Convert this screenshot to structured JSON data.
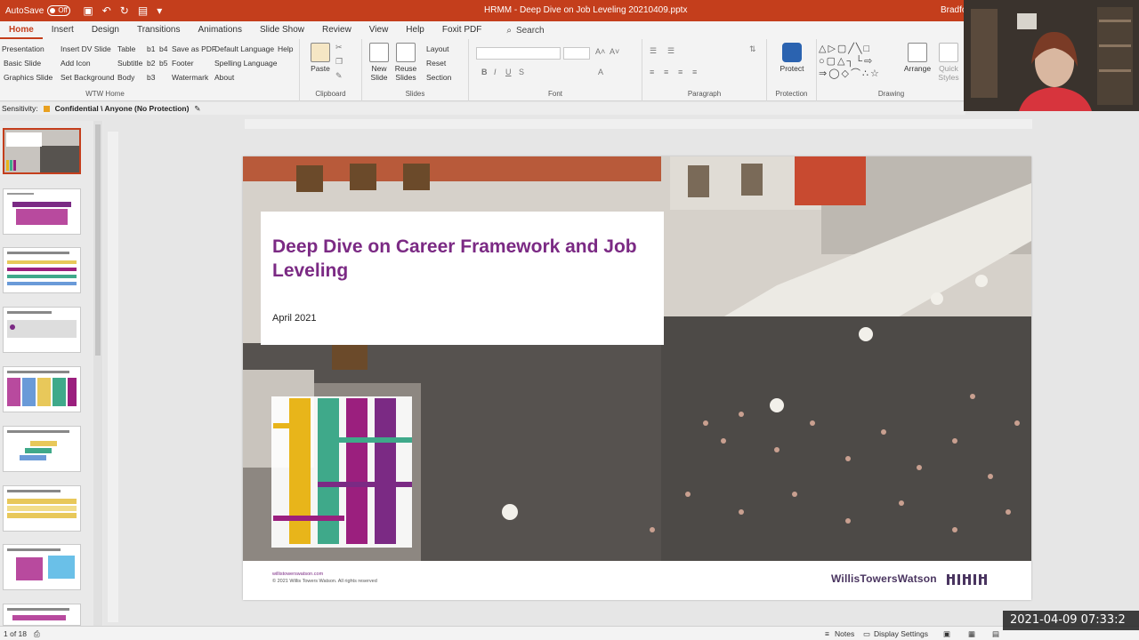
{
  "titlebar": {
    "autosave_label": "AutoSave",
    "autosave_state": "Off",
    "doc_title": "HRMM - Deep Dive on Job Leveling 20210409.pptx",
    "user": "Bradfo"
  },
  "tabs": [
    "Home",
    "Insert",
    "Design",
    "Transitions",
    "Animations",
    "Slide Show",
    "Review",
    "View",
    "Help",
    "Foxit PDF"
  ],
  "active_tab": "Home",
  "search_label": "Search",
  "ribbon": {
    "wtw_home": {
      "items": [
        "Presentation",
        "Basic Slide",
        "Graphics Slide",
        "Insert DV Slide",
        "Add Icon",
        "Set Background",
        "Table",
        "Subtitle",
        "Body",
        "b1",
        "b4",
        "b2",
        "b5",
        "b3",
        "Save as PDF",
        "Footer",
        "Watermark",
        "Default Language",
        "Spelling Language",
        "About",
        "Help"
      ],
      "label": "WTW Home"
    },
    "clipboard": {
      "paste": "Paste",
      "label": "Clipboard"
    },
    "slides": {
      "new_slide": "New Slide",
      "reuse_slides": "Reuse Slides",
      "layout": "Layout",
      "reset": "Reset",
      "section": "Section",
      "label": "Slides"
    },
    "font": {
      "label": "Font"
    },
    "paragraph": {
      "label": "Paragraph"
    },
    "protection": {
      "protect": "Protect",
      "label": "Protection"
    },
    "drawing": {
      "arrange": "Arrange",
      "quick_styles": "Quick Styles",
      "label": "Drawing"
    }
  },
  "sensitivity": {
    "label": "Sensitivity:",
    "value": "Confidential \\ Anyone (No Protection)"
  },
  "slide": {
    "title": "Deep Dive on Career Framework and Job Leveling",
    "date": "April 2021",
    "footer_url": "willistowerswatson.com",
    "footer_copy": "© 2021 Willis Towers Watson. All rights reserved",
    "brand": "WillisTowersWatson"
  },
  "statusbar": {
    "slide_count": "1 of 18",
    "notes": "Notes",
    "display_settings": "Display Settings"
  },
  "timestamp": "2021-04-09 07:33:2",
  "colors": {
    "accent": "#c43e1c",
    "purple": "#7b2a84",
    "teal": "#3fa98a",
    "yellow": "#e8b51a",
    "magenta": "#9b1f7e"
  }
}
